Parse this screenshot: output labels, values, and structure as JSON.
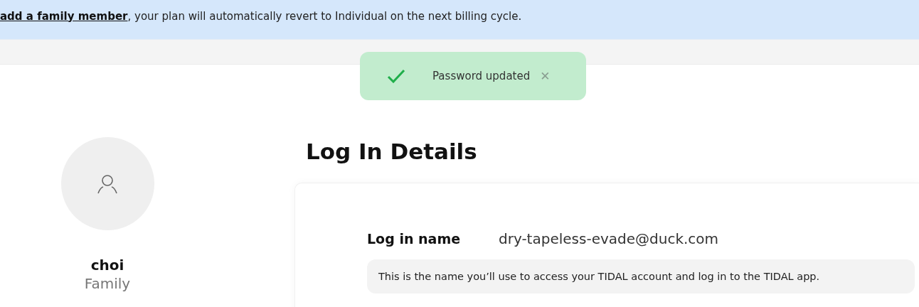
{
  "banner": {
    "link": "add a family member",
    "text": ", your plan will automatically revert to Individual on the next billing cycle."
  },
  "toast": {
    "message": "Password updated",
    "close": "✕"
  },
  "profile": {
    "name": "choi",
    "plan": "Family"
  },
  "login_details": {
    "title": "Log In Details",
    "label": "Log in name",
    "value": "dry-tapeless-evade@duck.com",
    "hint": "This is the name you’ll use to access your TIDAL account and log in to the TIDAL app."
  }
}
